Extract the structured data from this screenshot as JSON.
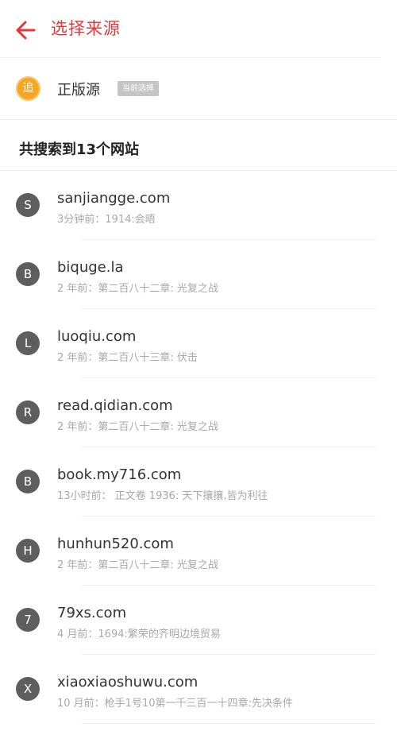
{
  "header": {
    "title": "选择来源",
    "accent_color": "#e0393a",
    "back_icon": "arrow-left-icon"
  },
  "current_source": {
    "logo_glyph": "追",
    "logo_color": "#f5a623",
    "label": "正版源",
    "badge": "当前选择"
  },
  "results": {
    "count_text": "共搜索到13个网站"
  },
  "sites": [
    {
      "avatar": "S",
      "name": "sanjiangge.com",
      "detail": "3分钟前：1914:会晤"
    },
    {
      "avatar": "B",
      "name": "biquge.la",
      "detail": "2 年前：第二百八十二章: 光复之战"
    },
    {
      "avatar": "L",
      "name": "luoqiu.com",
      "detail": "2 年前：第二百八十三章: 伏击"
    },
    {
      "avatar": "R",
      "name": "read.qidian.com",
      "detail": "2 年前：第二百八十二章: 光复之战"
    },
    {
      "avatar": "B",
      "name": "book.my716.com",
      "detail": "13小时前：  正文卷 1936: 天下攘攘,皆为利往"
    },
    {
      "avatar": "H",
      "name": "hunhun520.com",
      "detail": "2 年前：第二百八十二章: 光复之战"
    },
    {
      "avatar": "7",
      "name": "79xs.com",
      "detail": "4 月前：1694:繁荣的齐明边境贸易"
    },
    {
      "avatar": "X",
      "name": "xiaoxiaoshuwu.com",
      "detail": "10 月前：枪手1号10第一千三百一十四章:先决条件"
    }
  ]
}
